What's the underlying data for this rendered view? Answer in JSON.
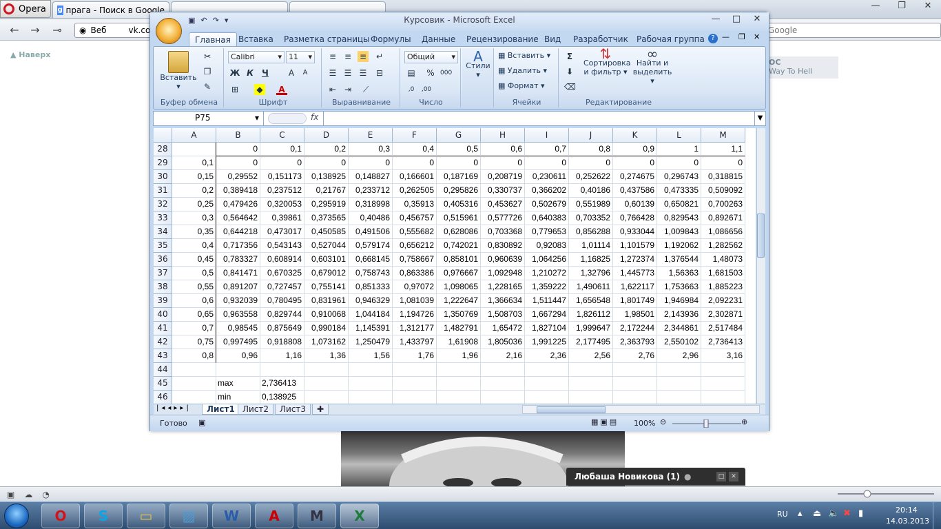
{
  "browser": {
    "menu_label": "Opera",
    "tabs": [
      {
        "label": "прага - Поиск в Google"
      },
      {
        "label": ""
      },
      {
        "label": ""
      }
    ],
    "address_prefix": "Веб",
    "address": "vk.com/",
    "search_placeholder": "Google",
    "back_to_top": "Наверх",
    "side_text_1": "ОС",
    "side_text_2": "Way To Hell"
  },
  "chat": {
    "title": "Любаша Новикова (1)"
  },
  "excel": {
    "title": "Курсовик - Microsoft Excel",
    "tabs": [
      "Главная",
      "Вставка",
      "Разметка страницы",
      "Формулы",
      "Данные",
      "Рецензирование",
      "Вид",
      "Разработчик",
      "Рабочая группа"
    ],
    "ribbon": {
      "paste": "Вставить",
      "clipboard": "Буфер обмена",
      "font_name": "Calibri",
      "font_size": "11",
      "font_group": "Шрифт",
      "align_group": "Выравнивание",
      "number_format": "Общий",
      "number_group": "Число",
      "styles": "Стили",
      "insert": "Вставить",
      "delete": "Удалить",
      "format": "Формат",
      "cells_group": "Ячейки",
      "sort_1": "Сортировка",
      "sort_2": "и фильтр",
      "find_1": "Найти и",
      "find_2": "выделить",
      "edit_group": "Редактирование",
      "sigma": "Σ",
      "bold": "Ж",
      "italic": "К",
      "underline": "Ч"
    },
    "name_box": "P75",
    "fx": "fx",
    "columns": [
      "A",
      "B",
      "C",
      "D",
      "E",
      "F",
      "G",
      "H",
      "I",
      "J",
      "K",
      "L",
      "M"
    ],
    "rows": [
      {
        "n": "28",
        "c": [
          "",
          "0",
          "0,1",
          "0,2",
          "0,3",
          "0,4",
          "0,5",
          "0,6",
          "0,7",
          "0,8",
          "0,9",
          "1",
          "1,1"
        ]
      },
      {
        "n": "29",
        "c": [
          "0,1",
          "0",
          "0",
          "0",
          "0",
          "0",
          "0",
          "0",
          "0",
          "0",
          "0",
          "0",
          "0"
        ]
      },
      {
        "n": "30",
        "c": [
          "0,15",
          "0,29552",
          "0,151173",
          "0,138925",
          "0,148827",
          "0,166601",
          "0,187169",
          "0,208719",
          "0,230611",
          "0,252622",
          "0,274675",
          "0,296743",
          "0,318815"
        ]
      },
      {
        "n": "31",
        "c": [
          "0,2",
          "0,389418",
          "0,237512",
          "0,21767",
          "0,233712",
          "0,262505",
          "0,295826",
          "0,330737",
          "0,366202",
          "0,40186",
          "0,437586",
          "0,473335",
          "0,509092"
        ]
      },
      {
        "n": "32",
        "c": [
          "0,25",
          "0,479426",
          "0,320053",
          "0,295919",
          "0,318998",
          "0,35913",
          "0,405316",
          "0,453627",
          "0,502679",
          "0,551989",
          "0,60139",
          "0,650821",
          "0,700263"
        ]
      },
      {
        "n": "33",
        "c": [
          "0,3",
          "0,564642",
          "0,39861",
          "0,373565",
          "0,40486",
          "0,456757",
          "0,515961",
          "0,577726",
          "0,640383",
          "0,703352",
          "0,766428",
          "0,829543",
          "0,892671"
        ]
      },
      {
        "n": "34",
        "c": [
          "0,35",
          "0,644218",
          "0,473017",
          "0,450585",
          "0,491506",
          "0,555682",
          "0,628086",
          "0,703368",
          "0,779653",
          "0,856288",
          "0,933044",
          "1,009843",
          "1,086656"
        ]
      },
      {
        "n": "35",
        "c": [
          "0,4",
          "0,717356",
          "0,543143",
          "0,527044",
          "0,579174",
          "0,656212",
          "0,742021",
          "0,830892",
          "0,92083",
          "1,01114",
          "1,101579",
          "1,192062",
          "1,282562"
        ]
      },
      {
        "n": "36",
        "c": [
          "0,45",
          "0,783327",
          "0,608914",
          "0,603101",
          "0,668145",
          "0,758667",
          "0,858101",
          "0,960639",
          "1,064256",
          "1,16825",
          "1,272374",
          "1,376544",
          "1,48073"
        ]
      },
      {
        "n": "37",
        "c": [
          "0,5",
          "0,841471",
          "0,670325",
          "0,679012",
          "0,758743",
          "0,863386",
          "0,976667",
          "1,092948",
          "1,210272",
          "1,32796",
          "1,445773",
          "1,56363",
          "1,681503"
        ]
      },
      {
        "n": "38",
        "c": [
          "0,55",
          "0,891207",
          "0,727457",
          "0,755141",
          "0,851333",
          "0,97072",
          "1,098065",
          "1,228165",
          "1,359222",
          "1,490611",
          "1,622117",
          "1,753663",
          "1,885223"
        ]
      },
      {
        "n": "39",
        "c": [
          "0,6",
          "0,932039",
          "0,780495",
          "0,831961",
          "0,946329",
          "1,081039",
          "1,222647",
          "1,366634",
          "1,511447",
          "1,656548",
          "1,801749",
          "1,946984",
          "2,092231"
        ]
      },
      {
        "n": "40",
        "c": [
          "0,65",
          "0,963558",
          "0,829744",
          "0,910068",
          "1,044184",
          "1,194726",
          "1,350769",
          "1,508703",
          "1,667294",
          "1,826112",
          "1,98501",
          "2,143936",
          "2,302871"
        ]
      },
      {
        "n": "41",
        "c": [
          "0,7",
          "0,98545",
          "0,875649",
          "0,990184",
          "1,145391",
          "1,312177",
          "1,482791",
          "1,65472",
          "1,827104",
          "1,999647",
          "2,172244",
          "2,344861",
          "2,517484"
        ]
      },
      {
        "n": "42",
        "c": [
          "0,75",
          "0,997495",
          "0,918808",
          "1,073162",
          "1,250479",
          "1,433797",
          "1,61908",
          "1,805036",
          "1,991225",
          "2,177495",
          "2,363793",
          "2,550102",
          "2,736413"
        ]
      },
      {
        "n": "43",
        "c": [
          "0,8",
          "0,96",
          "1,16",
          "1,36",
          "1,56",
          "1,76",
          "1,96",
          "2,16",
          "2,36",
          "2,56",
          "2,76",
          "2,96",
          "3,16"
        ]
      },
      {
        "n": "44",
        "c": [
          "",
          "",
          "",
          "",
          "",
          "",
          "",
          "",
          "",
          "",
          "",
          "",
          ""
        ]
      },
      {
        "n": "45",
        "c": [
          "",
          "max",
          "2,736413",
          "",
          "",
          "",
          "",
          "",
          "",
          "",
          "",
          "",
          ""
        ]
      },
      {
        "n": "46",
        "c": [
          "",
          "min",
          "0,138925",
          "",
          "",
          "",
          "",
          "",
          "",
          "",
          "",
          "",
          ""
        ]
      }
    ],
    "sheets": [
      "Лист1",
      "Лист2",
      "Лист3"
    ],
    "status": "Готово",
    "zoom": "100%"
  },
  "tray": {
    "lang": "RU",
    "time": "20:14",
    "date": "14.03.2013"
  }
}
